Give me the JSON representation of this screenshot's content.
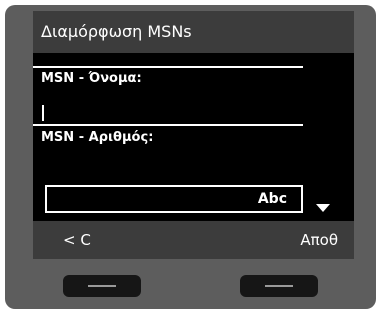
{
  "screen": {
    "title": "Διαμόρφωση MSNs",
    "fields": [
      {
        "label": "MSN - Όνομα:",
        "value": ""
      },
      {
        "label": "MSN - Αριθμός:",
        "value": ""
      }
    ],
    "input_mode": "Abc",
    "scroll_indicator": "down-arrow-icon"
  },
  "softkeys": {
    "left_label": "< C",
    "right_label": "Αποθ"
  },
  "colors": {
    "device_bezel": "#5d5d5d",
    "display_bar": "#3c3c3c",
    "display_bg": "#000000",
    "text": "#ffffff"
  }
}
